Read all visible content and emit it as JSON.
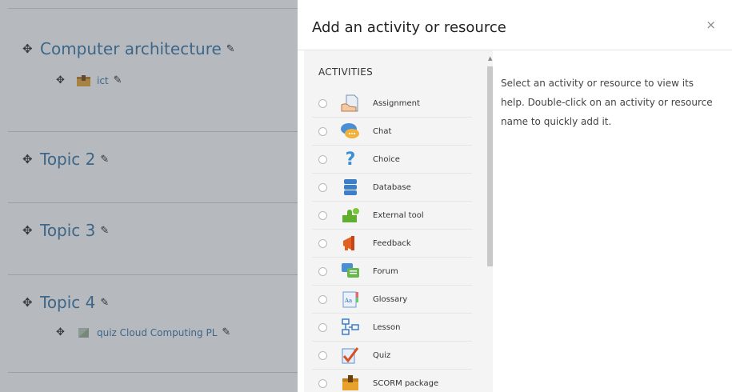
{
  "course": {
    "sections": [
      {
        "title": "Computer architecture",
        "modules": [
          {
            "name": "ict",
            "icon": "scorm-package-icon"
          }
        ]
      },
      {
        "title": "Topic 2",
        "modules": []
      },
      {
        "title": "Topic 3",
        "modules": []
      },
      {
        "title": "Topic 4",
        "modules": [
          {
            "name": "quiz Cloud Computing PL",
            "icon": "generic-activity-icon"
          }
        ]
      }
    ]
  },
  "dialog": {
    "title": "Add an activity or resource",
    "close": "×",
    "category": "ACTIVITIES",
    "help": "Select an activity or resource to view its help. Double-click on an activity or resource name to quickly add it.",
    "options": [
      {
        "label": "Assignment",
        "icon": "assignment-icon"
      },
      {
        "label": "Chat",
        "icon": "chat-icon"
      },
      {
        "label": "Choice",
        "icon": "choice-icon"
      },
      {
        "label": "Database",
        "icon": "database-icon"
      },
      {
        "label": "External tool",
        "icon": "external-tool-icon"
      },
      {
        "label": "Feedback",
        "icon": "feedback-icon"
      },
      {
        "label": "Forum",
        "icon": "forum-icon"
      },
      {
        "label": "Glossary",
        "icon": "glossary-icon"
      },
      {
        "label": "Lesson",
        "icon": "lesson-icon"
      },
      {
        "label": "Quiz",
        "icon": "quiz-icon"
      },
      {
        "label": "SCORM package",
        "icon": "scorm-package-icon"
      }
    ]
  }
}
